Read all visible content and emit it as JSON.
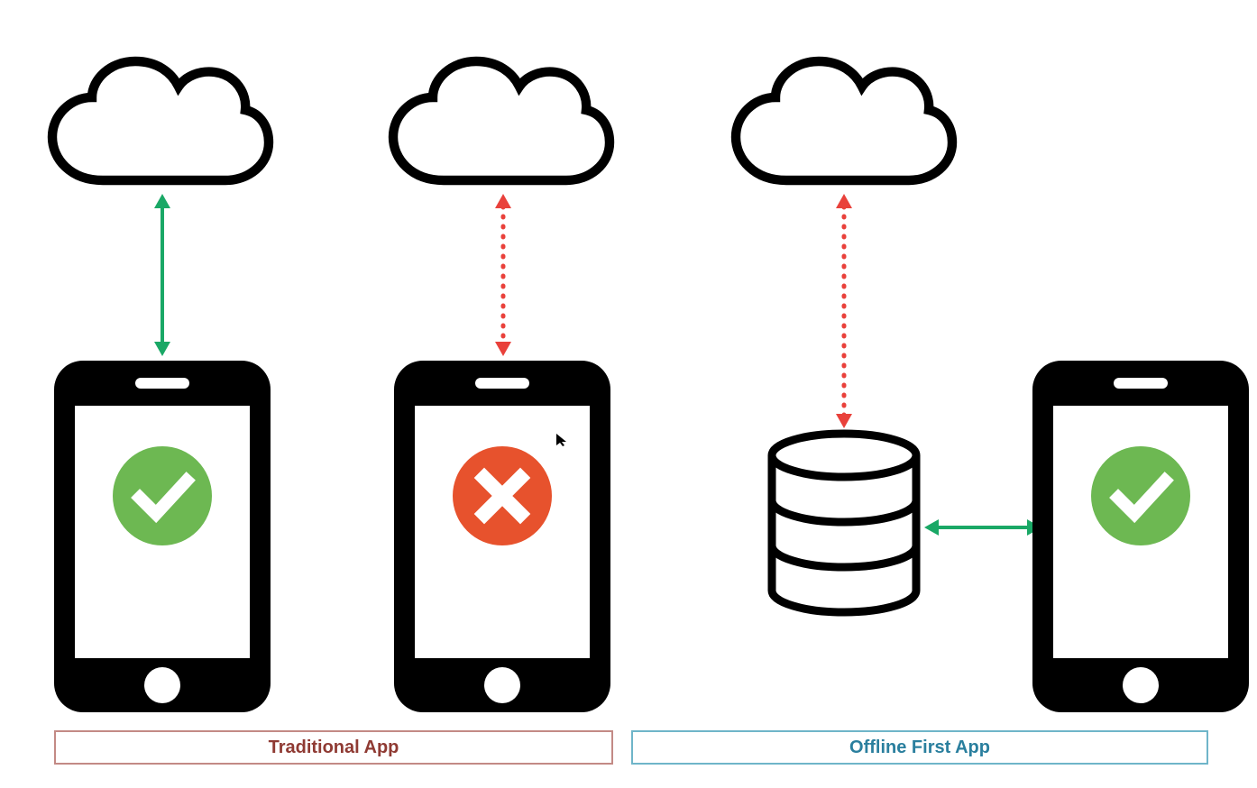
{
  "diagram": {
    "labels": {
      "traditional": "Traditional App",
      "offline_first": "Offline First App"
    },
    "colors": {
      "black": "#000000",
      "green": "#6db852",
      "green_arrow": "#1aa866",
      "red": "#e7522d",
      "red_arrow": "#e9413b",
      "label_red": "#8f3a33",
      "label_blue": "#2a7f9e",
      "box_red": "#c38a85",
      "box_blue": "#6fb5c9"
    },
    "icons": {
      "cloud1": "cloud-icon",
      "cloud2": "cloud-icon",
      "cloud3": "cloud-icon",
      "phone1": "smartphone-icon",
      "phone2": "smartphone-icon",
      "phone3": "smartphone-icon",
      "check1": "check-circle-icon",
      "cross": "cross-circle-icon",
      "check2": "check-circle-icon",
      "database": "database-icon",
      "arrow_solid_v": "double-arrow-vertical-solid-icon",
      "arrow_dotted_v": "double-arrow-vertical-dotted-icon",
      "arrow_solid_h": "double-arrow-horizontal-solid-icon",
      "cursor": "cursor-icon"
    },
    "entities": [
      {
        "id": "traditional_online",
        "components": [
          "cloud",
          "solid-green-arrow",
          "phone",
          "check"
        ]
      },
      {
        "id": "traditional_offline",
        "components": [
          "cloud",
          "dotted-red-arrow",
          "phone",
          "cross"
        ]
      },
      {
        "id": "offline_first",
        "components": [
          "cloud",
          "dotted-red-arrow",
          "database",
          "solid-green-arrow-horizontal",
          "phone",
          "check"
        ]
      }
    ]
  }
}
